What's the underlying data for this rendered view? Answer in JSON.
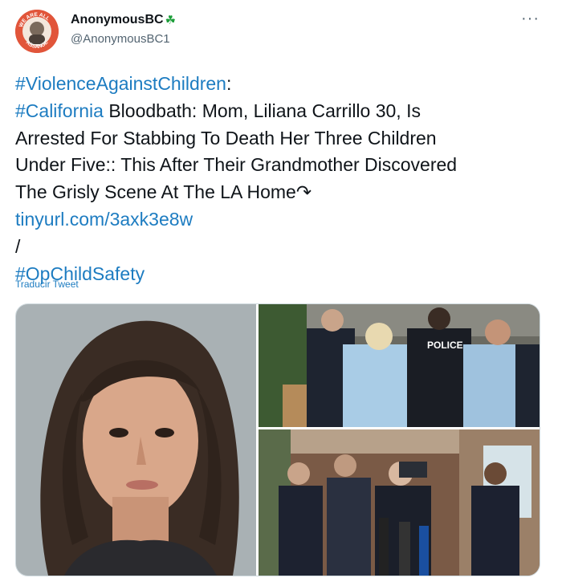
{
  "author": {
    "display_name": "AnonymousBC",
    "badge_emoji": "☘",
    "handle": "@AnonymousBC1",
    "avatar_text": "WE ARE ALL ASSANGE"
  },
  "menu_icon": "more-options-icon",
  "tweet": {
    "hashtag1": "#ViolenceAgainstChildren",
    "after_hashtag1": ":",
    "hashtag2": "#California",
    "line2_rest": " Bloodbath: Mom, Liliana Carrillo 30, Is",
    "line3": "Arrested For Stabbing To Death Her Three Children",
    "line4": "Under Five::  This After Their Grandmother Discovered",
    "line5": "The Grisly Scene At The LA Home↷",
    "url": "tinyurl.com/3axk3e8w",
    "slash": "/",
    "hashtag3": "#OpChildSafety"
  },
  "translate_label": "Traducir Tweet",
  "media": {
    "police_label": "POLICE"
  },
  "colors": {
    "link": "#1d7cc1",
    "text": "#0f1419",
    "muted": "#536471",
    "avatar_bg": "#e1553a"
  }
}
